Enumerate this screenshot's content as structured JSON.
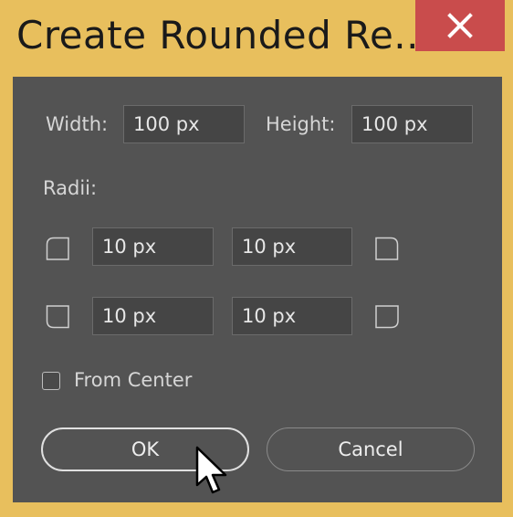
{
  "window": {
    "title": "Create Rounded Re...",
    "close_icon": "close-icon"
  },
  "size": {
    "width_label": "Width:",
    "width_value": "100 px",
    "height_label": "Height:",
    "height_value": "100 px"
  },
  "radii": {
    "label": "Radii:",
    "top_left": "10 px",
    "top_right": "10 px",
    "bottom_left": "10 px",
    "bottom_right": "10 px"
  },
  "options": {
    "from_center_label": "From Center",
    "from_center_checked": false
  },
  "buttons": {
    "ok_label": "OK",
    "cancel_label": "Cancel"
  },
  "colors": {
    "title_bar": "#e8bf5d",
    "close_button": "#c94c4c",
    "panel": "#535353"
  }
}
